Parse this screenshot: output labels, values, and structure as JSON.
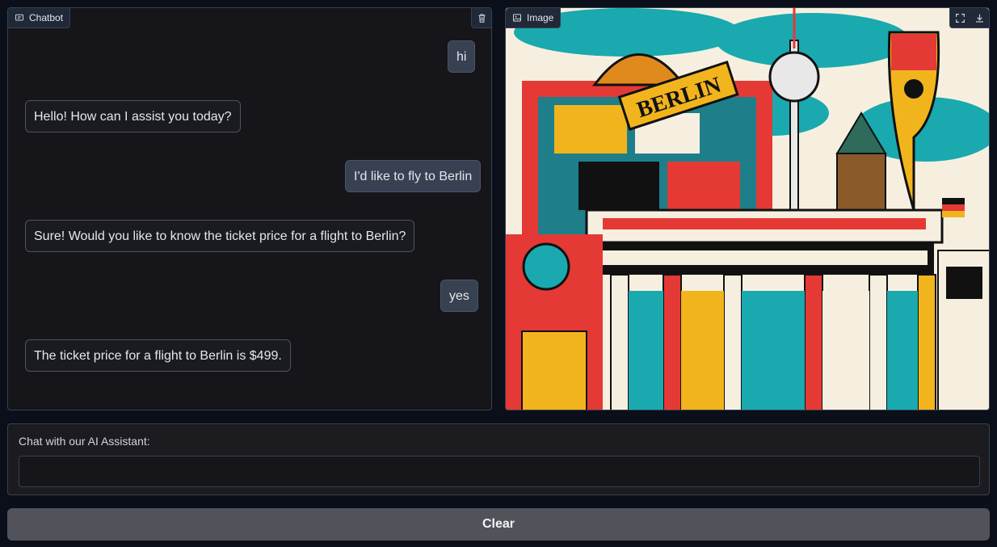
{
  "chatbot": {
    "label": "Chatbot",
    "icon": "chat-bubble-icon",
    "clear_icon": "trash-icon",
    "messages": [
      {
        "role": "user",
        "text": "hi"
      },
      {
        "role": "bot",
        "text": "Hello! How can I assist you today?"
      },
      {
        "role": "user",
        "text": "I'd like to fly to Berlin"
      },
      {
        "role": "bot",
        "text": "Sure! Would you like to know the ticket price for a flight to Berlin?"
      },
      {
        "role": "user",
        "text": "yes"
      },
      {
        "role": "bot",
        "text": "The ticket price for a flight to Berlin is $499."
      }
    ]
  },
  "image": {
    "label": "Image",
    "icon": "image-icon",
    "tools": [
      "fullscreen-icon",
      "download-icon"
    ],
    "sign_text": "BERLIN"
  },
  "input": {
    "label": "Chat with our AI Assistant:",
    "value": "",
    "placeholder": ""
  },
  "clear_button": {
    "label": "Clear"
  },
  "colors": {
    "background": "#0b0f19",
    "panel": "#15151a",
    "border": "#374151",
    "user_bubble": "#374151",
    "button": "#52525b"
  }
}
